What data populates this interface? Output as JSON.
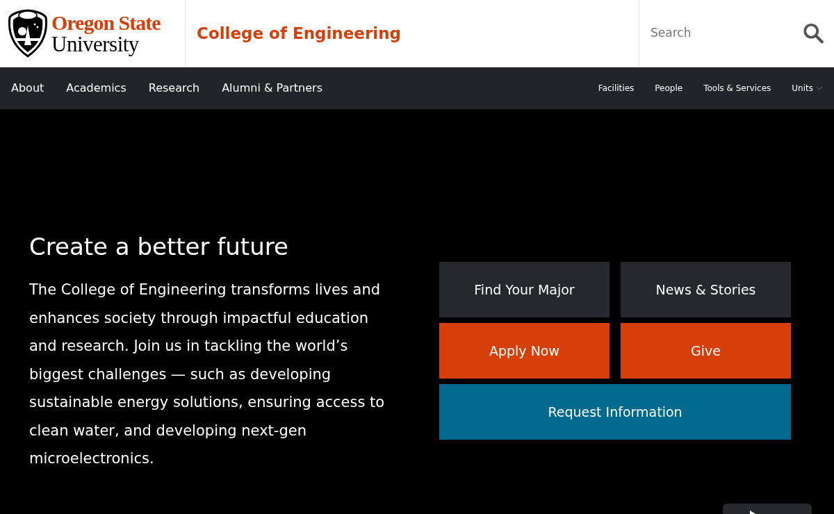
{
  "header": {
    "logo": {
      "line_1": "Oregon State",
      "line_2": "University"
    },
    "site_title": "College of Engineering",
    "search": {
      "placeholder": "Search"
    }
  },
  "nav": {
    "primary": [
      {
        "label": "About"
      },
      {
        "label": "Academics"
      },
      {
        "label": "Research"
      },
      {
        "label": "Alumni & Partners"
      }
    ],
    "secondary": [
      {
        "label": "Facilities",
        "kind": "link"
      },
      {
        "label": "People",
        "kind": "link"
      },
      {
        "label": "Tools & Services",
        "kind": "link"
      },
      {
        "label": "Units",
        "kind": "dropdown"
      }
    ]
  },
  "hero": {
    "heading": "Create a better future",
    "body": "The College of Engineering transforms lives and enhances society through impactful education and research. Join us in tackling the world’s biggest challenges — such as developing sustainable energy solutions, ensuring access to clean water, and developing next-gen microelectronics.",
    "buttons": [
      {
        "label": "Find Your Major",
        "kind": "dark"
      },
      {
        "label": "News & Stories",
        "kind": "dark"
      },
      {
        "label": "Apply Now",
        "kind": "orange"
      },
      {
        "label": "Give",
        "kind": "orange"
      },
      {
        "label": "Request Information",
        "kind": "blue"
      }
    ]
  }
}
